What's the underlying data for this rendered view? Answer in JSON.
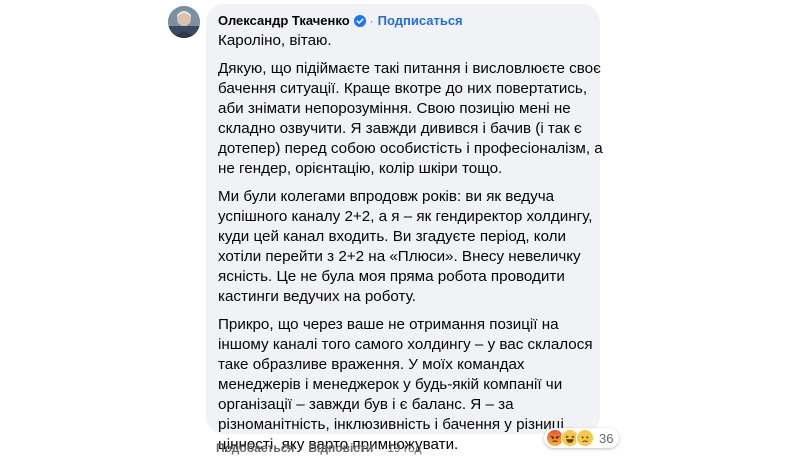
{
  "comment": {
    "author": "Олександр Ткаченко",
    "separator": "·",
    "subscribe_label": "Подписаться",
    "greeting": "Кароліно, вітаю.",
    "paragraphs": [
      {
        "lines": [
          "Дякую, що підіймаєте такі питання і висловлюєте своє",
          "бачення ситуації. Краще вкотре до них повертатись,",
          "аби знімати непорозуміння. Свою позицію мені не",
          "складно озвучити. Я завжди дивився і бачив (і так є",
          "дотепер) перед собою особистість і професіоналізм, а",
          "не гендер, орієнтацію, колір шкіри тощо."
        ]
      },
      {
        "lines": [
          "Ми були колегами впродовж років: ви як ведуча",
          "успішного каналу 2+2, а я – як гендиректор холдингу,",
          "куди цей канал входить. Ви згадуєте період, коли",
          "хотіли перейти з 2+2 на «Плюси». Внесу невеличку",
          "ясність. Це не була моя пряма робота проводити",
          "кастинги ведучих на роботу."
        ]
      },
      {
        "lines": [
          "Прикро, що через ваше не отримання позиції на",
          "іншому каналі того самого холдингу – у вас склалося",
          "таке образливе враження. У моїх командах",
          "менеджерів і менеджерок у будь-якій компанії чи",
          "організації – завжди був і є баланс. Я – за",
          "різноманітність, інклюзивність і бачення у різниці",
          "цінності, яку варто примножувати."
        ]
      }
    ],
    "reactions": {
      "icons": [
        "angry-reaction-icon",
        "haha-reaction-icon",
        "sad-reaction-icon"
      ],
      "count": "36"
    },
    "actions": {
      "like_label": "Подобається",
      "reply_label": "Відповісти",
      "separator": "·",
      "timestamp": "19 год"
    },
    "colors": {
      "bubble": "#f0f2f5",
      "link_blue": "#216fdb",
      "verified_blue": "#1877f2",
      "secondary_text": "#65676b"
    }
  }
}
